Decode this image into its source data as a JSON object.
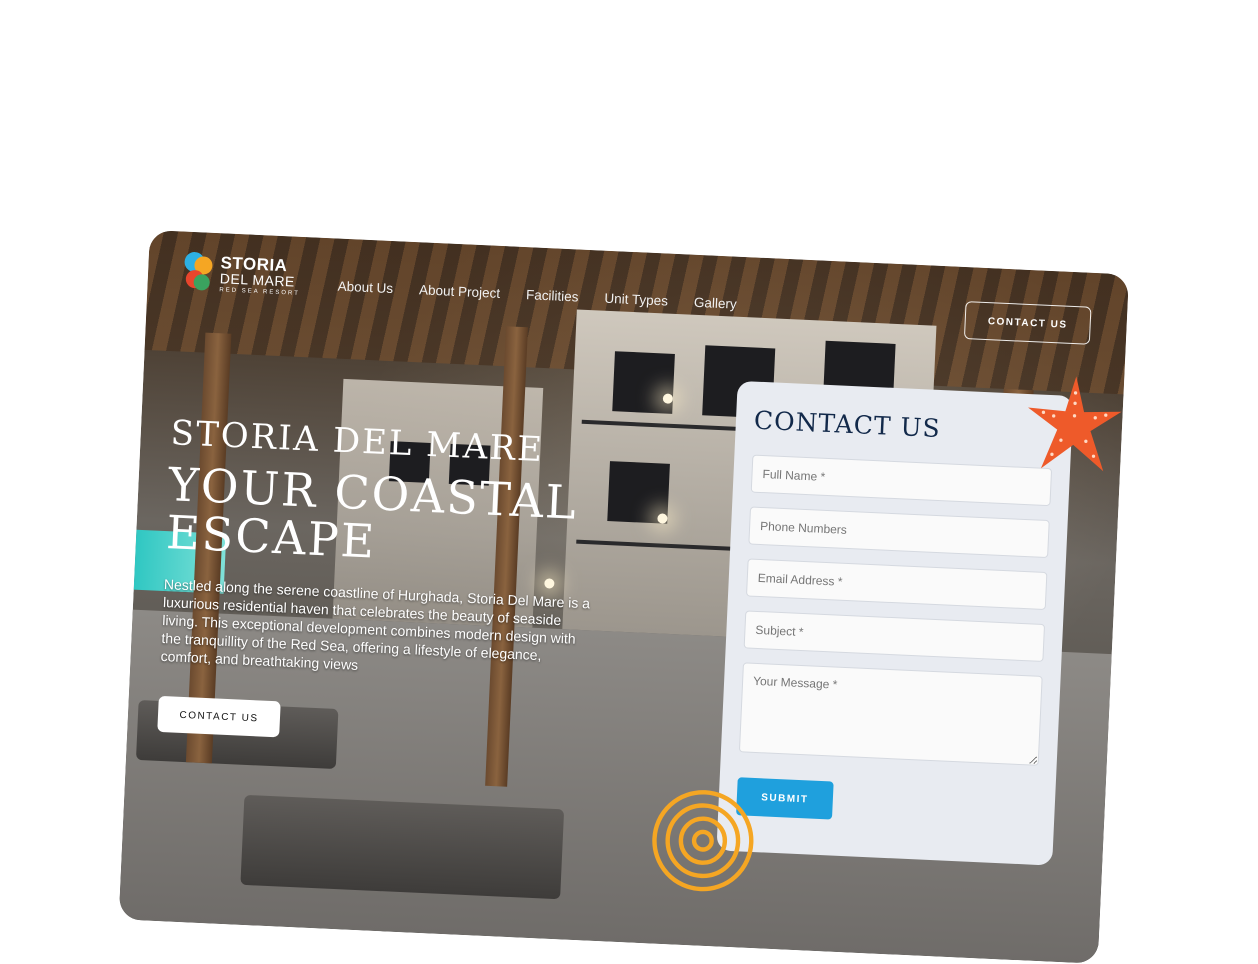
{
  "brand": {
    "line1": "STORIA",
    "line2": "DEL MARE",
    "line3": "RED SEA RESORT"
  },
  "nav": {
    "items": [
      "About Us",
      "About Project",
      "Facilities",
      "Unit Types",
      "Gallery"
    ],
    "cta": "CONTACT US"
  },
  "hero": {
    "title": "STORIA DEL MARE",
    "subtitle": "YOUR COASTAL ESCAPE",
    "description": "Nestled along the serene coastline of Hurghada, Storia Del Mare is a luxurious residential haven that celebrates the beauty of seaside living. This exceptional development combines modern design with the tranquillity of the Red Sea, offering a lifestyle of elegance, comfort, and breathtaking views",
    "cta": "CONTACT US"
  },
  "form": {
    "title": "CONTACT US",
    "full_name_placeholder": "Full Name *",
    "phone_placeholder": "Phone Numbers",
    "email_placeholder": "Email Address *",
    "subject_placeholder": "Subject *",
    "message_placeholder": "Your Message *",
    "submit": "SUBMIT"
  },
  "colors": {
    "accent": "#1fa0dd",
    "heading": "#12294a",
    "starfish": "#ee5a2a",
    "swirl": "#f5a623"
  }
}
